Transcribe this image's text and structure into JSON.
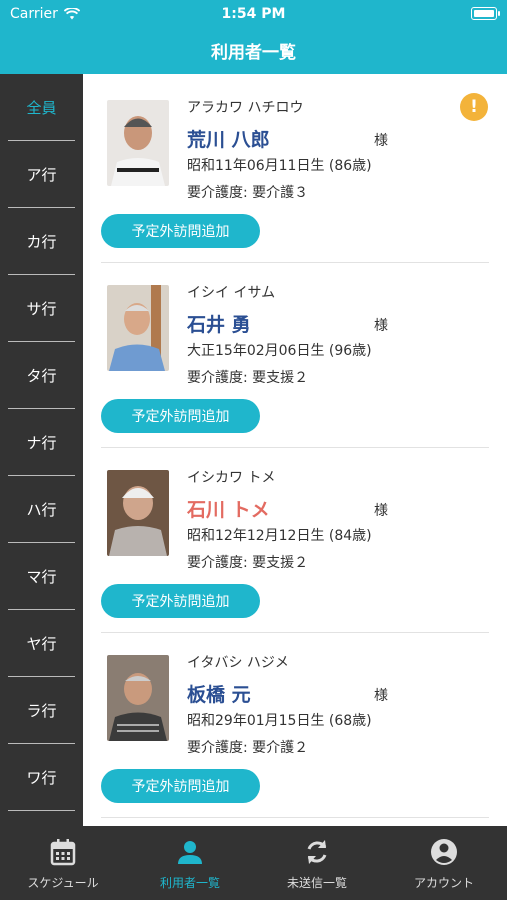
{
  "status_bar": {
    "carrier": "Carrier",
    "time": "1:54 PM"
  },
  "header": {
    "title": "利用者一覧"
  },
  "sidebar": {
    "items": [
      {
        "label": "全員",
        "active": true
      },
      {
        "label": "ア行"
      },
      {
        "label": "カ行"
      },
      {
        "label": "サ行"
      },
      {
        "label": "タ行"
      },
      {
        "label": "ナ行"
      },
      {
        "label": "ハ行"
      },
      {
        "label": "マ行"
      },
      {
        "label": "ヤ行"
      },
      {
        "label": "ラ行"
      },
      {
        "label": "ワ行"
      }
    ]
  },
  "residents": [
    {
      "kana": "アラカワ ハチロウ",
      "name": "荒川 八郎",
      "honorific": "様",
      "birth": "昭和11年06月11日生 (86歳)",
      "care_level": "要介護度: 要介護３",
      "button": "予定外訪問追加",
      "alert": "!",
      "name_color": "#2b4f93"
    },
    {
      "kana": "イシイ イサム",
      "name": "石井 勇",
      "honorific": "様",
      "birth": "大正15年02月06日生 (96歳)",
      "care_level": "要介護度: 要支援２",
      "button": "予定外訪問追加",
      "name_color": "#2b4f93"
    },
    {
      "kana": "イシカワ トメ",
      "name": "石川 トメ",
      "honorific": "様",
      "birth": "昭和12年12月12日生 (84歳)",
      "care_level": "要介護度: 要支援２",
      "button": "予定外訪問追加",
      "name_color": "#e36b61"
    },
    {
      "kana": "イタバシ ハジメ",
      "name": "板橋 元",
      "honorific": "様",
      "birth": "昭和29年01月15日生 (68歳)",
      "care_level": "要介護度: 要介護２",
      "button": "予定外訪問追加",
      "name_color": "#2b4f93"
    }
  ],
  "tabbar": {
    "tabs": [
      {
        "label": "スケジュール",
        "icon": "calendar-icon"
      },
      {
        "label": "利用者一覧",
        "icon": "person-icon",
        "active": true
      },
      {
        "label": "未送信一覧",
        "icon": "sync-icon"
      },
      {
        "label": "アカウント",
        "icon": "account-circle-icon"
      }
    ]
  },
  "colors": {
    "accent": "#1fb6cc",
    "dark": "#333333",
    "alert": "#f3b33a"
  }
}
